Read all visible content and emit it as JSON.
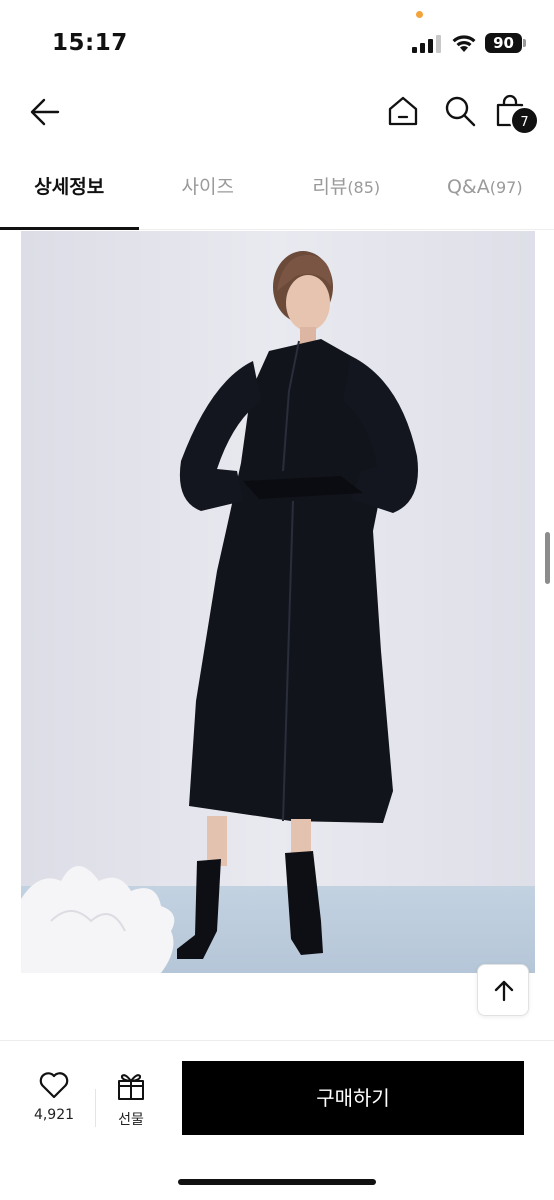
{
  "status_bar": {
    "time": "15:17",
    "battery": "90"
  },
  "nav": {
    "cart_badge": "7",
    "icons": [
      "back-arrow-icon",
      "home-icon",
      "search-icon",
      "shopping-bag-icon"
    ]
  },
  "tabs": [
    {
      "label": "상세정보",
      "count": "",
      "active": true
    },
    {
      "label": "사이즈",
      "count": "",
      "active": false
    },
    {
      "label": "리뷰",
      "count": "(85)",
      "active": false
    },
    {
      "label": "Q&A",
      "count": "(97)",
      "active": false
    }
  ],
  "bottom_bar": {
    "like_count": "4,921",
    "gift_label": "선물",
    "buy_label": "구매하기"
  },
  "colors": {
    "primary": "#000000",
    "tab_inactive": "#9a9a9a",
    "background": "#ffffff"
  }
}
